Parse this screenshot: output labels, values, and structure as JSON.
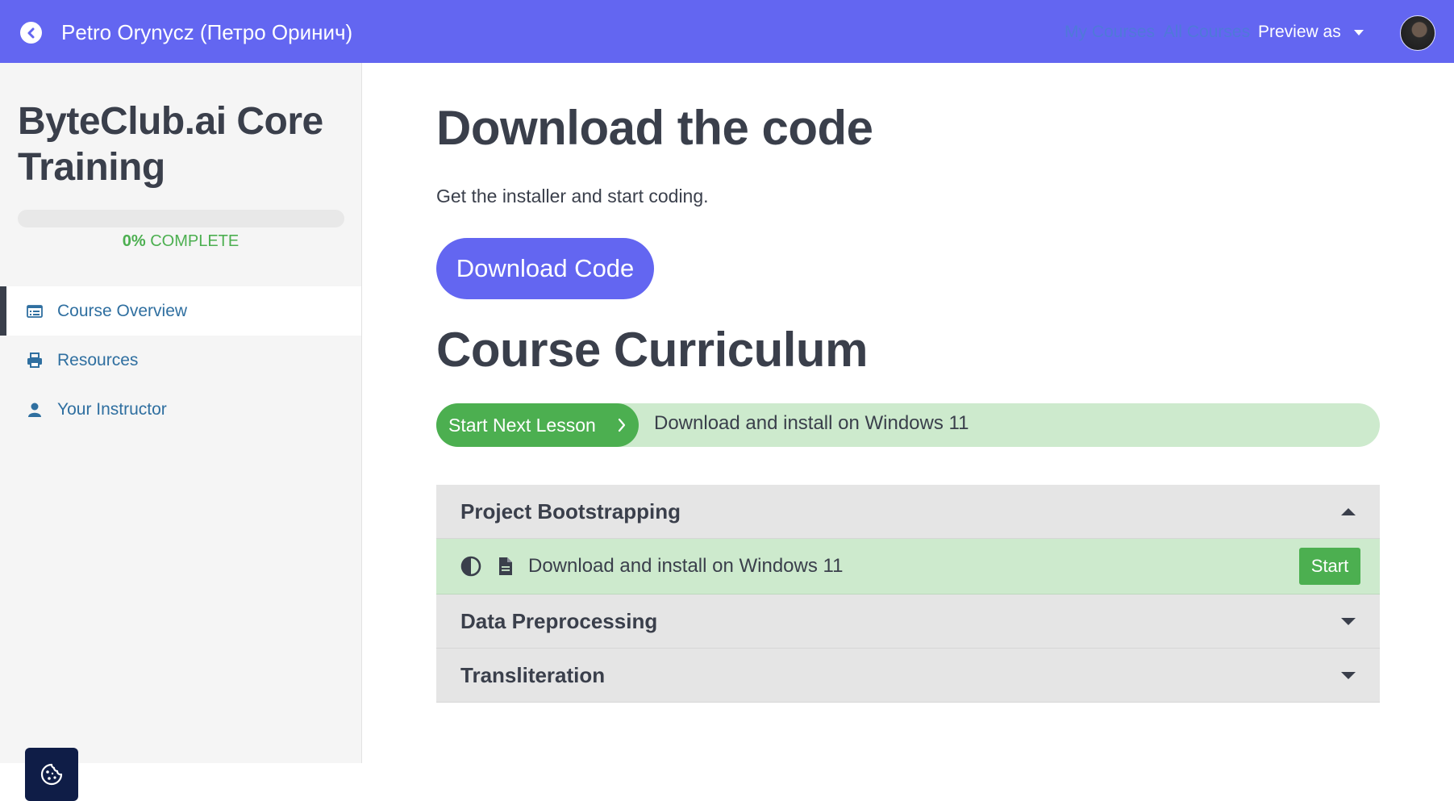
{
  "topbar": {
    "back_icon": "chevron-left-circle-icon",
    "title": "Petro Orynycz (Петро Оринич)",
    "links": [
      "My Courses",
      "All Courses"
    ],
    "preview_label": "Preview as",
    "accent_color": "#6366f1"
  },
  "sidebar": {
    "course_title": "ByteClub.ai Core Training",
    "progress": {
      "percent_value": 0,
      "percent_label": "0%",
      "complete_label": "COMPLETE"
    },
    "nav": [
      {
        "label": "Course Overview",
        "icon": "list-icon",
        "active": true
      },
      {
        "label": "Resources",
        "icon": "printer-icon",
        "active": false
      },
      {
        "label": "Your Instructor",
        "icon": "user-icon",
        "active": false
      }
    ],
    "cookie_icon": "cookie-icon"
  },
  "main": {
    "download_heading": "Download the code",
    "download_subtitle": "Get the installer and start coding.",
    "download_button": "Download Code",
    "curriculum_heading": "Course Curriculum",
    "next_lesson": {
      "button_label": "Start Next Lesson",
      "lesson_name": "Download and install on Windows 11"
    },
    "sections": [
      {
        "title": "Project Bootstrapping",
        "expanded": true,
        "lessons": [
          {
            "status_icon": "half-circle-icon",
            "type_icon": "document-icon",
            "name": "Download and install on Windows 11",
            "action": "Start"
          }
        ]
      },
      {
        "title": "Data Preprocessing",
        "expanded": false,
        "lessons": []
      },
      {
        "title": "Transliteration",
        "expanded": false,
        "lessons": []
      }
    ]
  }
}
